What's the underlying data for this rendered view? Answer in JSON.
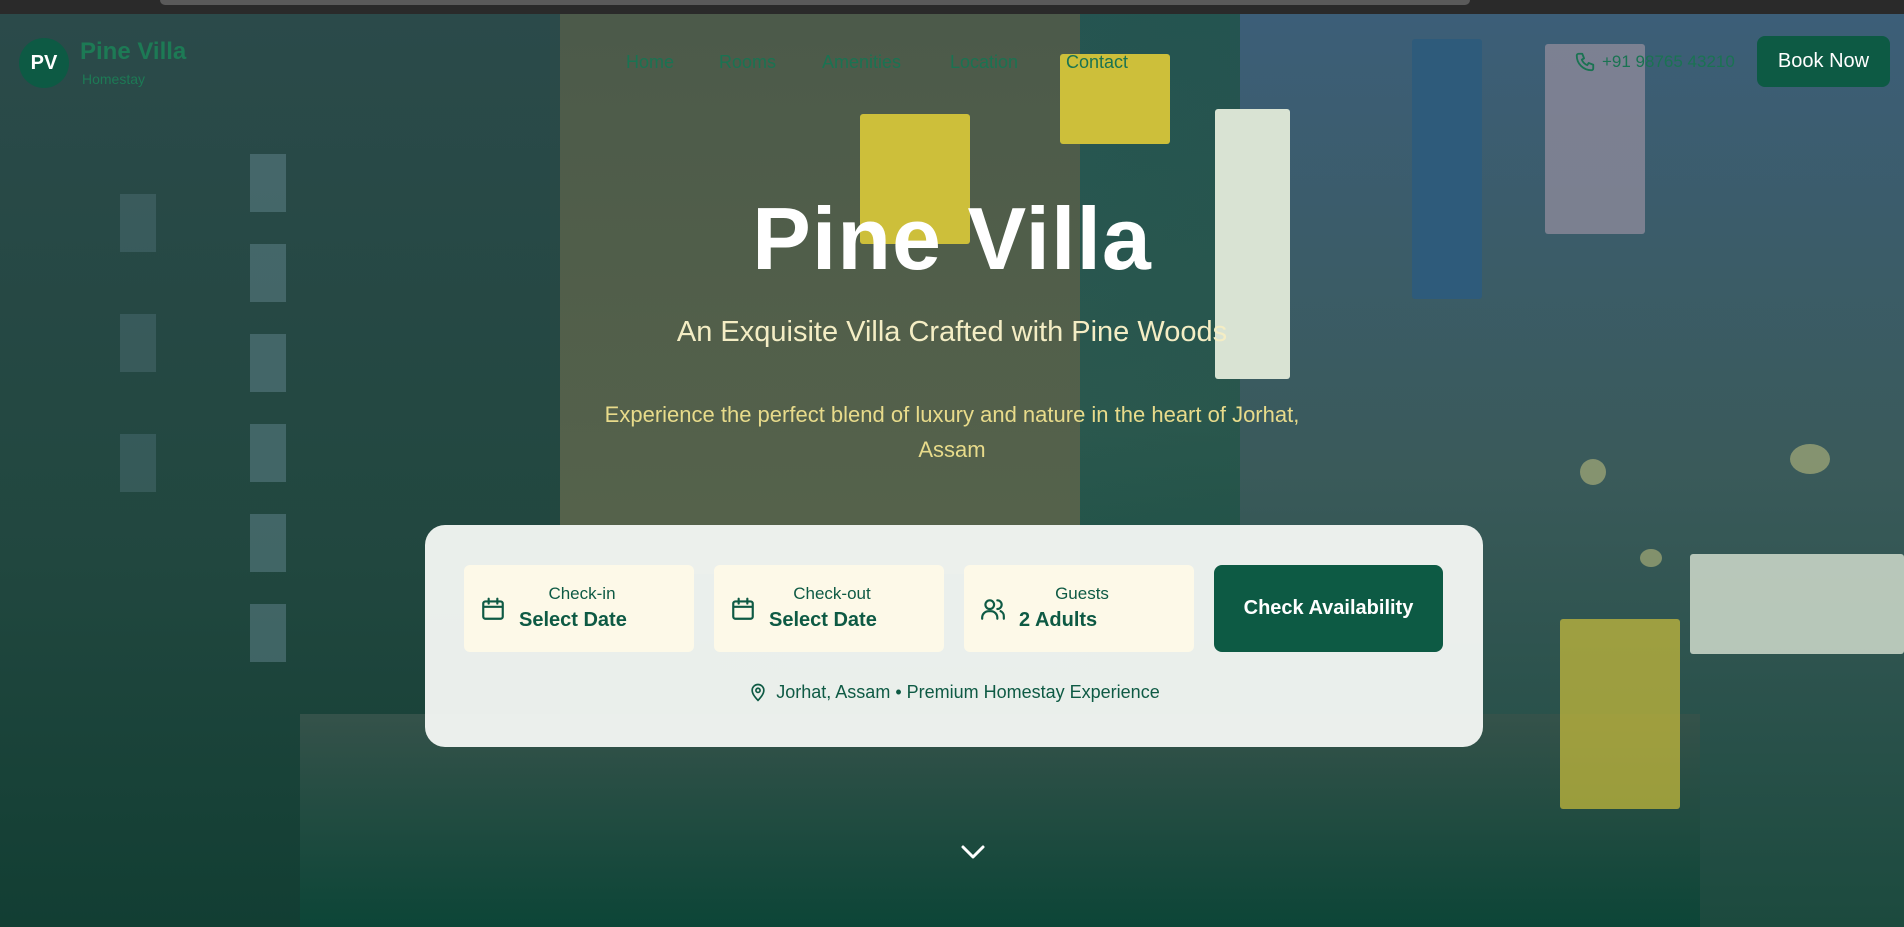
{
  "header": {
    "logo_initials": "PV",
    "logo_title": "Pine Villa",
    "logo_subtitle": "Homestay",
    "nav": [
      "Home",
      "Rooms",
      "Amenities",
      "Location",
      "Contact"
    ],
    "phone": "+91 98765 43210",
    "book_now": "Book Now"
  },
  "hero": {
    "title": "Pine Villa",
    "subtitle": "An Exquisite Villa Crafted with Pine Woods",
    "tagline": "Experience the perfect blend of luxury and nature in the heart of Jorhat, Assam"
  },
  "booking": {
    "checkin_label": "Check-in",
    "checkin_value": "Select Date",
    "checkout_label": "Check-out",
    "checkout_value": "Select Date",
    "guests_label": "Guests",
    "guests_value": "2 Adults",
    "cta": "Check Availability",
    "location_note": "Jorhat, Assam • Premium Homestay Experience"
  },
  "icons": {
    "phone": "phone-icon",
    "calendar": "calendar-icon",
    "guests": "users-icon",
    "location": "map-pin-icon",
    "scroll": "chevron-down-icon"
  },
  "colors": {
    "brand": "#0d5a44",
    "accent_text": "#e8db8b",
    "card_bg": "#f3f6f3",
    "field_bg": "#fdf9e8"
  }
}
